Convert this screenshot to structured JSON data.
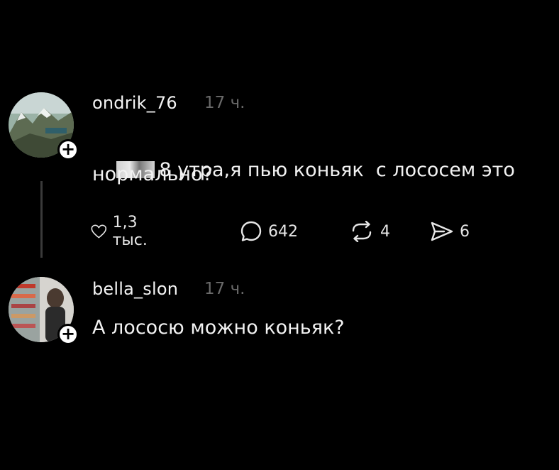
{
  "comments": [
    {
      "username": "ondrik_76",
      "time": "17 ч.",
      "text_line1": "8 утра,я пью коньяк  с лососем это",
      "text_line2": "нормально?",
      "actions": {
        "likes": "1,3 тыс.",
        "replies": "642",
        "reposts": "4",
        "shares": "6"
      }
    },
    {
      "username": "bella_slon",
      "time": "17 ч.",
      "text_line1": "А лососю можно коньяк?"
    }
  ],
  "badge_symbol": "+",
  "icons": {
    "like": "heart-icon",
    "reply": "comment-bubble-icon",
    "repost": "repost-icon",
    "share": "send-icon"
  },
  "colors": {
    "background": "#000000",
    "text": "#f2f2f2",
    "muted": "#6a6a6a"
  }
}
